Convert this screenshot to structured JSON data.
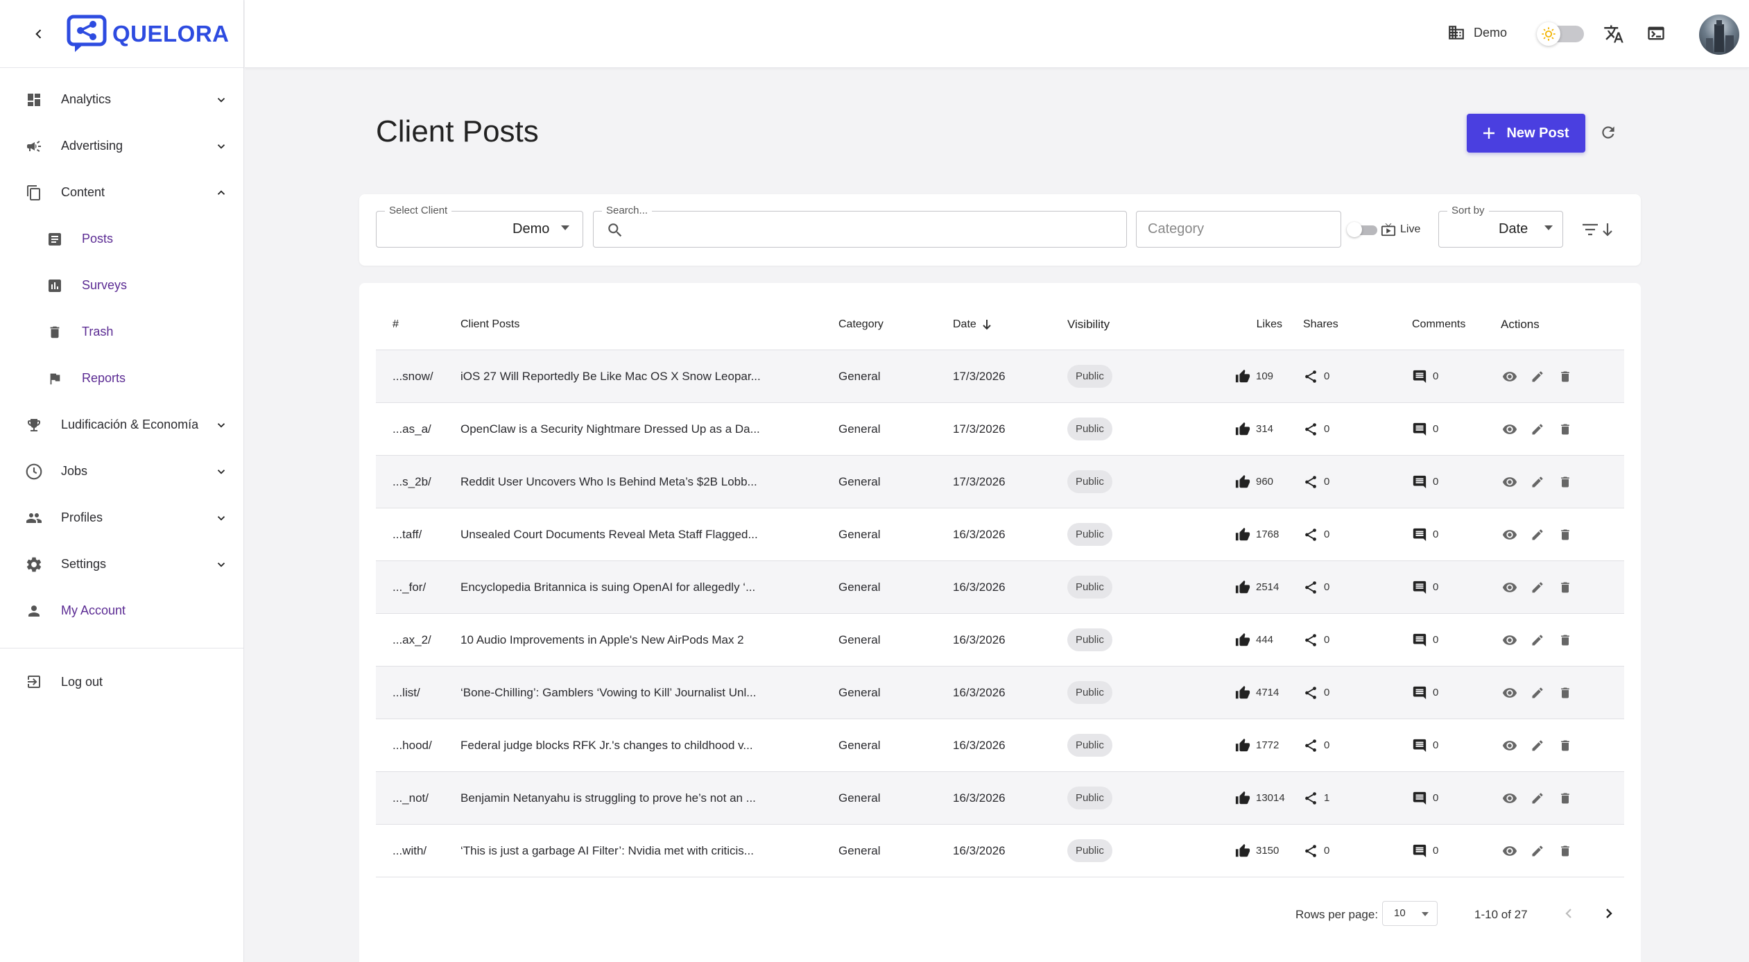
{
  "brand": {
    "name": "QUELORA"
  },
  "sidebar": {
    "items": [
      {
        "label": "Analytics",
        "icon": "dashboard-icon",
        "expanded": false
      },
      {
        "label": "Advertising",
        "icon": "megaphone-icon",
        "expanded": false
      },
      {
        "label": "Content",
        "icon": "copy-icon",
        "expanded": true
      },
      {
        "label": "Ludificación & Economía",
        "icon": "trophy-icon",
        "expanded": false
      },
      {
        "label": "Jobs",
        "icon": "clock-icon",
        "expanded": false
      },
      {
        "label": "Profiles",
        "icon": "people-icon",
        "expanded": false
      },
      {
        "label": "Settings",
        "icon": "gear-icon",
        "expanded": false
      },
      {
        "label": "My Account",
        "icon": "person-icon"
      }
    ],
    "content_sub": [
      {
        "label": "Posts",
        "icon": "article-icon"
      },
      {
        "label": "Surveys",
        "icon": "bar-chart-icon"
      },
      {
        "label": "Trash",
        "icon": "trash-icon"
      },
      {
        "label": "Reports",
        "icon": "flag-icon"
      }
    ],
    "logout": "Log out"
  },
  "topbar": {
    "client": "Demo"
  },
  "header": {
    "title": "Client Posts",
    "new_post": "New Post"
  },
  "filters": {
    "client_label": "Select Client",
    "client_value": "Demo",
    "search_label": "Search...",
    "category_placeholder": "Category",
    "live_label": "Live",
    "sort_label": "Sort by",
    "sort_value": "Date"
  },
  "table": {
    "headers": {
      "id": "#",
      "title": "Client Posts",
      "category": "Category",
      "date": "Date",
      "visibility": "Visibility",
      "likes": "Likes",
      "shares": "Shares",
      "comments": "Comments",
      "actions": "Actions"
    },
    "rows": [
      {
        "id": "...snow/",
        "title": "iOS 27 Will Reportedly Be Like Mac OS X Snow Leopar...",
        "category": "General",
        "date": "17/3/2026",
        "visibility": "Public",
        "likes": "109",
        "shares": "0",
        "comments": "0"
      },
      {
        "id": "...as_a/",
        "title": "OpenClaw is a Security Nightmare Dressed Up as a Da...",
        "category": "General",
        "date": "17/3/2026",
        "visibility": "Public",
        "likes": "314",
        "shares": "0",
        "comments": "0"
      },
      {
        "id": "...s_2b/",
        "title": "Reddit User Uncovers Who Is Behind Meta’s $2B Lobb...",
        "category": "General",
        "date": "17/3/2026",
        "visibility": "Public",
        "likes": "960",
        "shares": "0",
        "comments": "0"
      },
      {
        "id": "...taff/",
        "title": "Unsealed Court Documents Reveal Meta Staff Flagged...",
        "category": "General",
        "date": "16/3/2026",
        "visibility": "Public",
        "likes": "1768",
        "shares": "0",
        "comments": "0"
      },
      {
        "id": "..._for/",
        "title": "Encyclopedia Britannica is suing OpenAI for allegedly ‘...",
        "category": "General",
        "date": "16/3/2026",
        "visibility": "Public",
        "likes": "2514",
        "shares": "0",
        "comments": "0"
      },
      {
        "id": "...ax_2/",
        "title": "10 Audio Improvements in Apple's New AirPods Max 2",
        "category": "General",
        "date": "16/3/2026",
        "visibility": "Public",
        "likes": "444",
        "shares": "0",
        "comments": "0"
      },
      {
        "id": "...list/",
        "title": "‘Bone-Chilling’: Gamblers ‘Vowing to Kill’ Journalist Unl...",
        "category": "General",
        "date": "16/3/2026",
        "visibility": "Public",
        "likes": "4714",
        "shares": "0",
        "comments": "0"
      },
      {
        "id": "...hood/",
        "title": "Federal judge blocks RFK Jr.'s changes to childhood v...",
        "category": "General",
        "date": "16/3/2026",
        "visibility": "Public",
        "likes": "1772",
        "shares": "0",
        "comments": "0"
      },
      {
        "id": "..._not/",
        "title": "Benjamin Netanyahu is struggling to prove he’s not an ...",
        "category": "General",
        "date": "16/3/2026",
        "visibility": "Public",
        "likes": "13014",
        "shares": "1",
        "comments": "0"
      },
      {
        "id": "...with/",
        "title": "‘This is just a garbage AI Filter’: Nvidia met with criticis...",
        "category": "General",
        "date": "16/3/2026",
        "visibility": "Public",
        "likes": "3150",
        "shares": "0",
        "comments": "0"
      }
    ]
  },
  "pagination": {
    "rows_label": "Rows per page:",
    "rows_value": "10",
    "range": "1-10 of 27"
  },
  "colors": {
    "accent": "#4a3fe0",
    "brand": "#2d4be0",
    "sub_nav": "#5b2b93"
  }
}
